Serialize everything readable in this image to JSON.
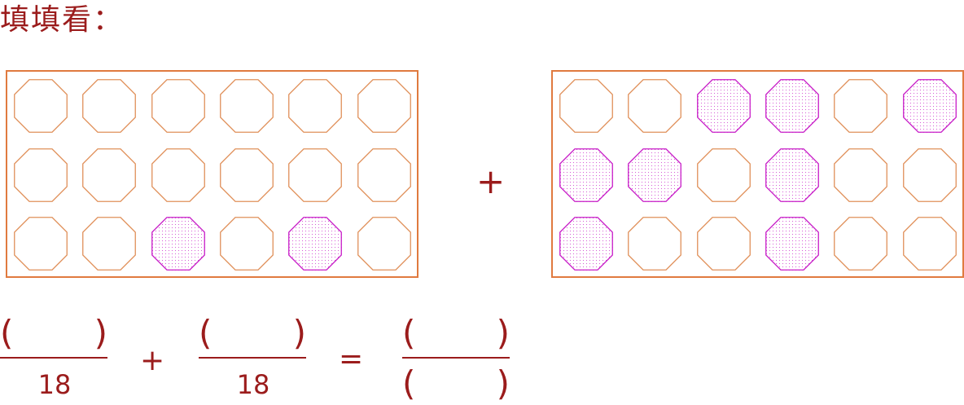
{
  "title": "填填看：",
  "colors": {
    "text": "#9b1c1c",
    "frame": "#e07a3f",
    "empty_outline": "#e0905a",
    "shaded_outline": "#c81ec8",
    "shaded_dots": "#d65ad6"
  },
  "left_grid": {
    "rows": 3,
    "cols": 6,
    "shaded": [
      [
        false,
        false,
        false,
        false,
        false,
        false
      ],
      [
        false,
        false,
        false,
        false,
        false,
        false
      ],
      [
        false,
        false,
        true,
        false,
        true,
        false
      ]
    ]
  },
  "plus_between_grids": "+",
  "right_grid": {
    "rows": 3,
    "cols": 6,
    "shaded": [
      [
        false,
        false,
        true,
        true,
        false,
        true
      ],
      [
        true,
        true,
        false,
        true,
        false,
        false
      ],
      [
        true,
        false,
        false,
        true,
        false,
        false
      ]
    ]
  },
  "equation": {
    "frac1": {
      "numerator": "(　　　)",
      "denominator": "18"
    },
    "plus": "+",
    "frac2": {
      "numerator": "(　　　)",
      "denominator": "18"
    },
    "equals": "=",
    "frac3": {
      "numerator": "(　　　)",
      "denominator": "(　　　)"
    }
  }
}
